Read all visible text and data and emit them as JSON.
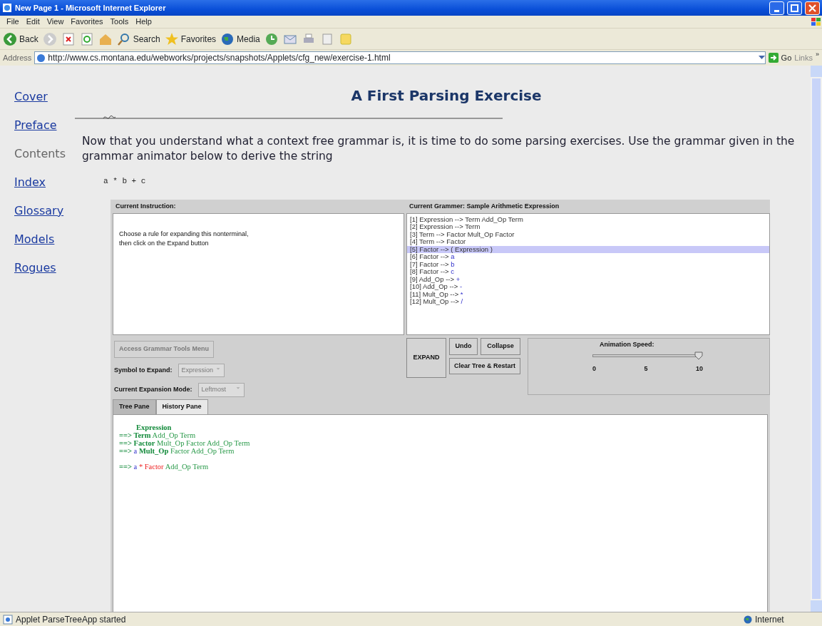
{
  "window": {
    "title": "New Page 1 - Microsoft Internet Explorer"
  },
  "menu": [
    "File",
    "Edit",
    "View",
    "Favorites",
    "Tools",
    "Help"
  ],
  "toolbar": {
    "back": "Back",
    "search": "Search",
    "favorites": "Favorites",
    "media": "Media"
  },
  "address": {
    "label": "Address",
    "url": "http://www.cs.montana.edu/webworks/projects/snapshots/Applets/cfg_new/exercise-1.html",
    "go": "Go",
    "links": "Links",
    "more": "»"
  },
  "nav": [
    {
      "label": "Cover",
      "current": false
    },
    {
      "label": "Preface",
      "current": false
    },
    {
      "label": "Contents",
      "current": true
    },
    {
      "label": "Index",
      "current": false
    },
    {
      "label": "Glossary",
      "current": false
    },
    {
      "label": "Models",
      "current": false
    },
    {
      "label": "Rogues",
      "current": false
    }
  ],
  "page": {
    "heading": "A First Parsing Exercise",
    "intro": "Now that you understand what a context free grammar is, it is time to do some parsing exercises.  Use the grammar given in the grammar animator below to derive the string",
    "target": "a * b + c"
  },
  "applet": {
    "instruction": {
      "title": "Current Instruction:",
      "lines": [
        "Choose a rule for expanding this nonterminal,",
        "then click on the Expand button"
      ]
    },
    "grammar": {
      "title": "Current Grammer:  Sample Arithmetic Expression",
      "rules": [
        {
          "number": "[1]",
          "body": "Expression --> Term Add_Op Term",
          "selected": false
        },
        {
          "number": "[2]",
          "body": "Expression --> Term",
          "selected": false
        },
        {
          "number": "[3]",
          "body": "Term --> Factor Mult_Op Factor",
          "selected": false
        },
        {
          "number": "[4]",
          "body": "Term --> Factor",
          "selected": false
        },
        {
          "number": "[5]",
          "body": "Factor --> ( Expression )",
          "selected": true
        },
        {
          "number": "[6]",
          "body": "Factor -->",
          "terminal": "a",
          "selected": false
        },
        {
          "number": "[7]",
          "body": "Factor -->",
          "terminal": "b",
          "selected": false
        },
        {
          "number": "[8]",
          "body": "Factor -->",
          "terminal": "c",
          "selected": false
        },
        {
          "number": "[9]",
          "body": "Add_Op -->",
          "terminal": "+",
          "selected": false
        },
        {
          "number": "[10]",
          "body": "Add_Op -->",
          "terminal": "-",
          "selected": false
        },
        {
          "number": "[11]",
          "body": "Mult_Op -->",
          "terminal": "*",
          "selected": false
        },
        {
          "number": "[12]",
          "body": "Mult_Op -->",
          "terminal": "/",
          "selected": false
        }
      ]
    },
    "tools_button": {
      "label": "Access Grammar Tools Menu",
      "disabled": true
    },
    "symbol": {
      "label": "Symbol to Expand:",
      "value": "Expression",
      "disabled": true
    },
    "mode": {
      "label": "Current Expansion Mode:",
      "value": "Leftmost",
      "disabled": true
    },
    "buttons": {
      "expand": "EXPAND",
      "undo": "Undo",
      "collapse": "Collapse",
      "clear": "Clear Tree & Restart"
    },
    "speed": {
      "label": "Animation Speed:",
      "level": 1.0,
      "ticks": [
        "0",
        "5",
        "10"
      ]
    },
    "tabs": [
      {
        "label": "Tree Pane",
        "selected": false
      },
      {
        "label": "History Pane",
        "selected": true
      }
    ],
    "history": [
      {
        "tokens": [
          {
            "text": "Expression",
            "kind": "active"
          }
        ]
      },
      {
        "arrow": "==>",
        "tokens": [
          {
            "text": "Term",
            "kind": "active"
          },
          {
            "text": "Add_Op Term",
            "kind": "plain"
          }
        ]
      },
      {
        "arrow": "==>",
        "tokens": [
          {
            "text": "Factor",
            "kind": "active"
          },
          {
            "text": "Mult_Op Factor Add_Op Term",
            "kind": "plain"
          }
        ]
      },
      {
        "arrow": "==>",
        "tokens": [
          {
            "text": "a",
            "kind": "terminal"
          },
          {
            "text": "Mult_Op",
            "kind": "active"
          },
          {
            "text": "Factor Add_Op Term",
            "kind": "plain"
          }
        ]
      },
      {
        "arrow": "==>",
        "tokens": [
          {
            "text": "a",
            "kind": "terminal"
          },
          {
            "text": "*",
            "kind": "current"
          },
          {
            "text": "Factor",
            "kind": "current"
          },
          {
            "text": "Add_Op Term",
            "kind": "plain"
          }
        ]
      }
    ]
  },
  "status_bar": {
    "text": "Applet ParseTreeApp started",
    "zone": "Internet"
  }
}
